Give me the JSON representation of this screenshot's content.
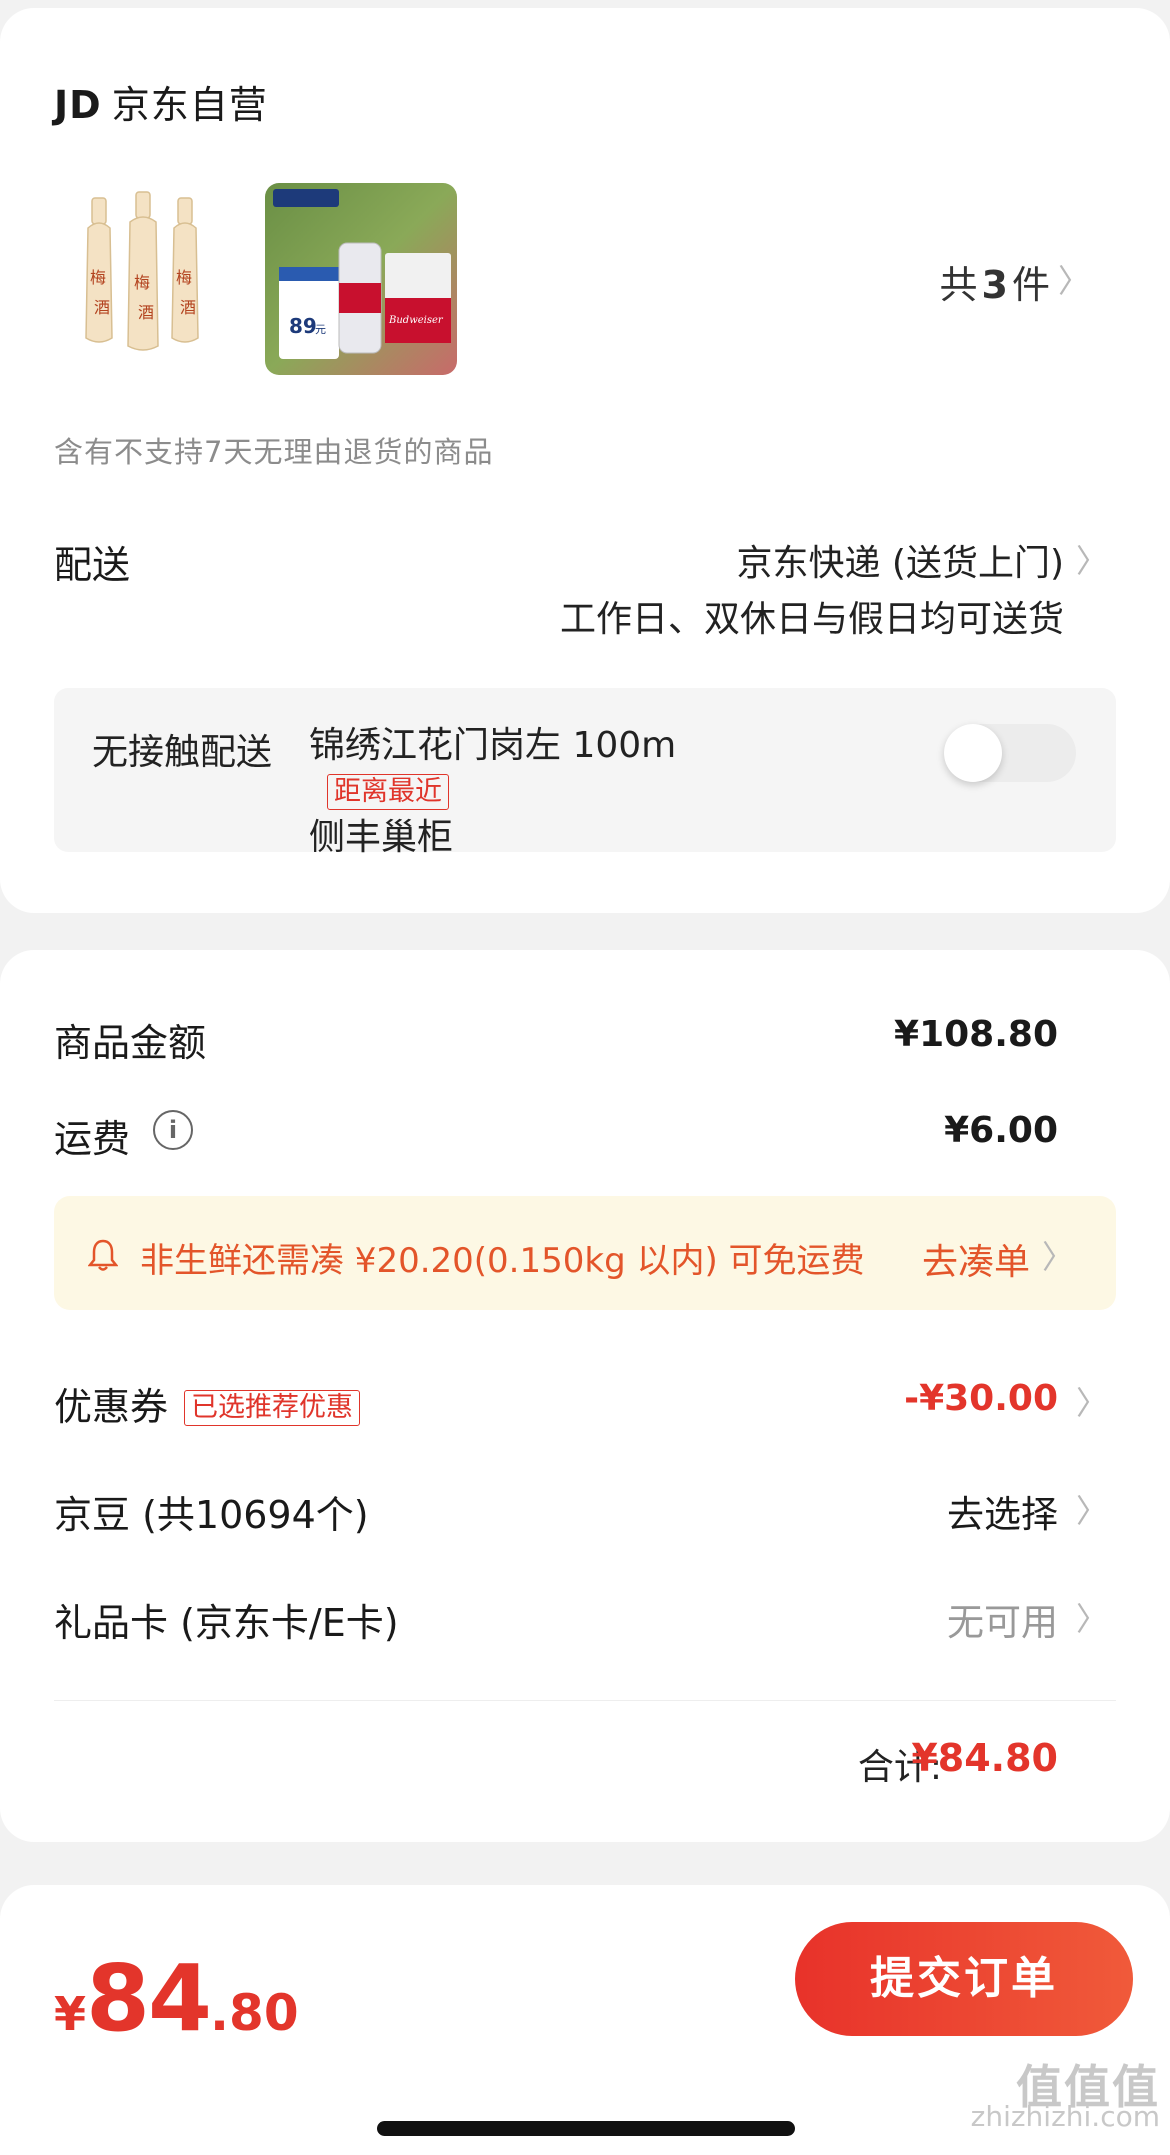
{
  "shop": {
    "logo_text": "JD",
    "name": "京东自营"
  },
  "products": {
    "count_prefix": "共",
    "count": "3",
    "count_suffix": "件",
    "item1_label": "梅子酒",
    "item2_banner": "PLUS会员专享",
    "item2_price": "89",
    "item2_price_unit": "元",
    "item2_brand": "Budweiser"
  },
  "return_note": "含有不支持7天无理由退货的商品",
  "delivery": {
    "label": "配送",
    "method": "京东快递 (送货上门)",
    "time": "工作日、双休日与假日均可送货",
    "contactless_label": "无接触配送",
    "address_line1": "锦绣江花门岗左 100m",
    "address_line2": "侧丰巢柜",
    "distance_tag": "距离最近",
    "toggle_on": false
  },
  "amounts": {
    "goods_label": "商品金额",
    "goods_value": "¥108.80",
    "shipping_label": "运费",
    "shipping_value": "¥6.00",
    "info_icon": "info-icon",
    "tip_text": "非生鲜还需凑 ¥20.20(0.150kg 以内) 可免运费",
    "tip_link": "去凑单",
    "coupon_label": "优惠券",
    "coupon_tag": "已选推荐优惠",
    "coupon_value": "-¥30.00",
    "beans_label": "京豆 (共10694个)",
    "beans_value": "去选择",
    "giftcard_label": "礼品卡 (京东卡/E卡)",
    "giftcard_value": "无可用",
    "total_label": "合计:",
    "total_value": "¥84.80"
  },
  "footer": {
    "currency": "¥",
    "price_int": "84",
    "price_dec": ".80",
    "submit_label": "提交订单"
  },
  "watermark": {
    "big": "值值值",
    "small": "zhizhizhi.com"
  },
  "colors": {
    "accent": "#e3352b",
    "tip_bg": "#fdf8e4",
    "tip_text": "#e3552a"
  }
}
